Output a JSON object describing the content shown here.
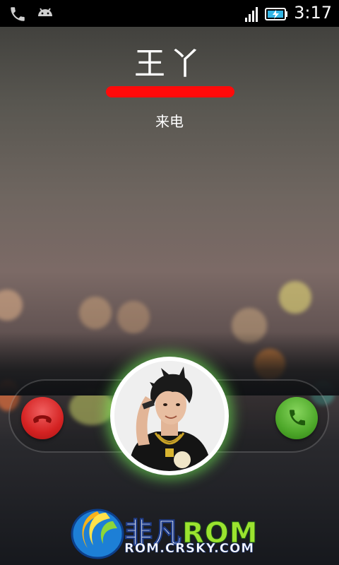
{
  "status_bar": {
    "time": "3:17",
    "icons": [
      "phone-icon",
      "android-icon",
      "signal-icon",
      "battery-charging-icon"
    ]
  },
  "caller": {
    "name": "王丫",
    "number": "",
    "status": "来电"
  },
  "actions": {
    "decline_icon": "hangup-icon",
    "answer_icon": "phone-answer-icon",
    "decline_color": "#d42222",
    "answer_color": "#4ea82a"
  },
  "watermark": {
    "brand_a": "非凡",
    "brand_b": "ROM",
    "url": "ROM.CRSKY.COM"
  }
}
